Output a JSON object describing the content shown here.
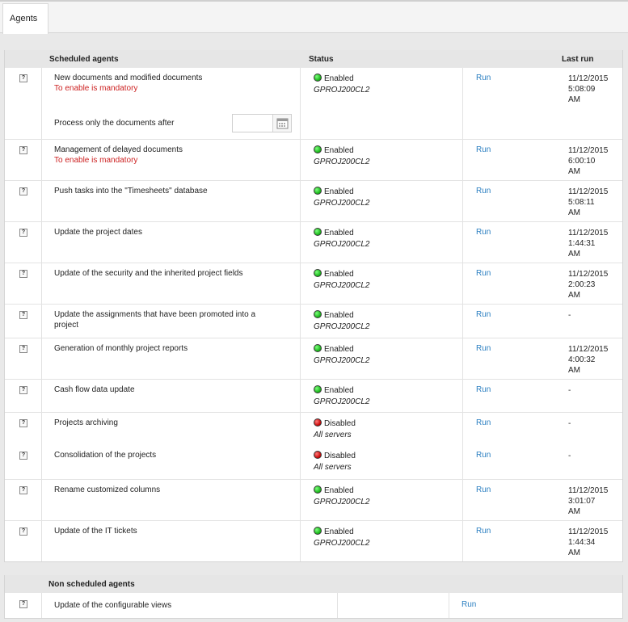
{
  "tab": {
    "label": "Agents"
  },
  "scheduled": {
    "headers": {
      "name": "Scheduled agents",
      "status": "Status",
      "last_run": "Last run"
    },
    "filter_label": "Process only the documents after",
    "filter_value": "",
    "agents": [
      {
        "name": "New documents and modified documents",
        "note": "To enable is mandatory",
        "status": "Enabled",
        "server": "GPROJ200CL2",
        "action": "Run",
        "last_run": [
          "11/12/2015",
          "5:08:09",
          "AM"
        ]
      },
      {
        "name": "Management of delayed documents",
        "note": "To enable is mandatory",
        "status": "Enabled",
        "server": "GPROJ200CL2",
        "action": "Run",
        "last_run": [
          "11/12/2015",
          "6:00:10",
          "AM"
        ]
      },
      {
        "name": "Push tasks into the \"Timesheets\" database",
        "note": "",
        "status": "Enabled",
        "server": "GPROJ200CL2",
        "action": "Run",
        "last_run": [
          "11/12/2015",
          "5:08:11",
          "AM"
        ]
      },
      {
        "name": "Update the project dates",
        "note": "",
        "status": "Enabled",
        "server": "GPROJ200CL2",
        "action": "Run",
        "last_run": [
          "11/12/2015",
          "1:44:31",
          "AM"
        ]
      },
      {
        "name": "Update of the security and the inherited project fields",
        "note": "",
        "status": "Enabled",
        "server": "GPROJ200CL2",
        "action": "Run",
        "last_run": [
          "11/12/2015",
          "2:00:23",
          "AM"
        ]
      },
      {
        "name": "Update the assignments that have been promoted into a project",
        "note": "",
        "status": "Enabled",
        "server": "GPROJ200CL2",
        "action": "Run",
        "last_run": [
          "-",
          "",
          ""
        ]
      },
      {
        "name": "Generation of monthly project reports",
        "note": "",
        "status": "Enabled",
        "server": "GPROJ200CL2",
        "action": "Run",
        "last_run": [
          "11/12/2015",
          "4:00:32",
          "AM"
        ]
      },
      {
        "name": "Cash flow data update",
        "note": "",
        "status": "Enabled",
        "server": "GPROJ200CL2",
        "action": "Run",
        "last_run": [
          "-",
          "",
          ""
        ]
      },
      {
        "name": "Projects archiving",
        "note": "",
        "status": "Disabled",
        "server": "All servers",
        "action": "Run",
        "last_run": [
          "-",
          "",
          ""
        ]
      },
      {
        "name": "Consolidation of the projects",
        "note": "",
        "status": "Disabled",
        "server": "All servers",
        "action": "Run",
        "last_run": [
          "-",
          "",
          ""
        ]
      },
      {
        "name": "Rename customized columns",
        "note": "",
        "status": "Enabled",
        "server": "GPROJ200CL2",
        "action": "Run",
        "last_run": [
          "11/12/2015",
          "3:01:07",
          "AM"
        ]
      },
      {
        "name": "Update of the IT tickets",
        "note": "",
        "status": "Enabled",
        "server": "GPROJ200CL2",
        "action": "Run",
        "last_run": [
          "11/12/2015",
          "1:44:34",
          "AM"
        ]
      }
    ]
  },
  "non_scheduled": {
    "header": "Non scheduled agents",
    "agents": [
      {
        "name": "Update of the configurable views",
        "action": "Run"
      }
    ]
  },
  "help_glyph": "?",
  "icons": {
    "help": "help-icon",
    "status_enabled": "green-dot-icon",
    "status_disabled": "red-dot-icon",
    "calendar": "calendar-icon"
  },
  "colors": {
    "link": "#2b7fc1",
    "mandatory": "#cc1f1f",
    "enabled": "#13b013",
    "disabled": "#c40000"
  }
}
